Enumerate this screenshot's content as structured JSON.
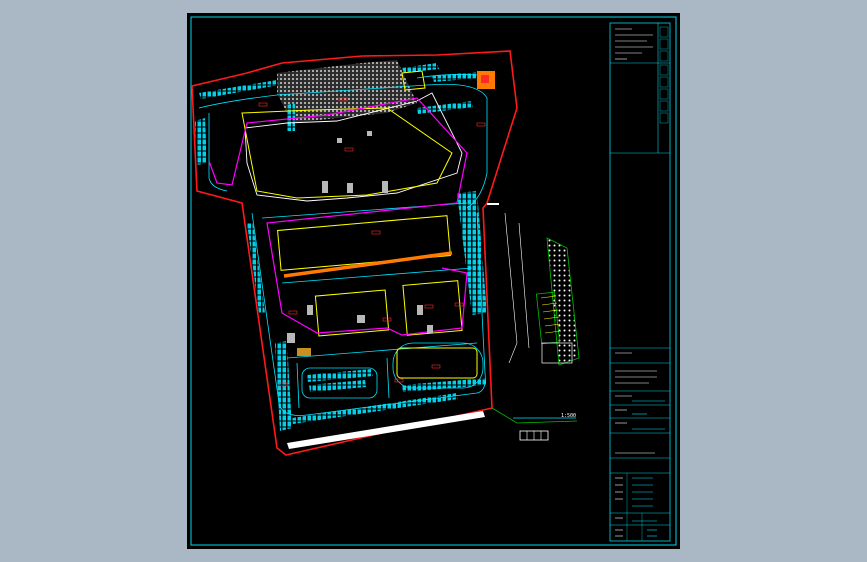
{
  "colors": {
    "background": "#a9b8c4",
    "sheet": "#000000",
    "frame": "#00d8e6",
    "boundary": "#ff1a1a",
    "road": "#00e5ff",
    "building": "#ffff00",
    "route": "#ff00ff",
    "highlight": "#ff7a00",
    "green_line": "#00c000",
    "plaza_fill": "#b8b8b8"
  },
  "title_block": {
    "scale_label": "1:500"
  }
}
